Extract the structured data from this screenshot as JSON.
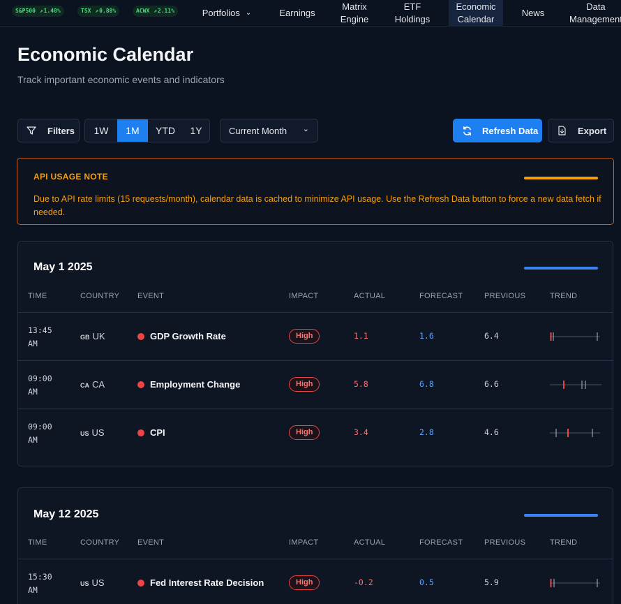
{
  "nav": {
    "tickers": [
      {
        "symbol": "S&P500",
        "change": "1.48%"
      },
      {
        "symbol": "TSX",
        "change": "0.88%"
      },
      {
        "symbol": "ACWX",
        "change": "2.11%"
      }
    ],
    "items": [
      {
        "label": "Portfolios"
      },
      {
        "label": "Earnings"
      },
      {
        "line1": "Matrix",
        "line2": "Engine"
      },
      {
        "line1": "ETF",
        "line2": "Holdings"
      },
      {
        "line1": "Economic",
        "line2": "Calendar"
      },
      {
        "label": "News"
      },
      {
        "line1": "Data",
        "line2": "Management"
      }
    ]
  },
  "page": {
    "title": "Economic Calendar",
    "subtitle": "Track important economic events and indicators"
  },
  "toolbar": {
    "filters_label": "Filters",
    "ranges": [
      "1W",
      "1M",
      "YTD",
      "1Y"
    ],
    "active_range": "1M",
    "period_select": "Current Month",
    "refresh_label": "Refresh Data",
    "export_label": "Export",
    "accent_color": "#1e7ff0"
  },
  "note": {
    "title": "API USAGE NOTE",
    "body": "Due to API rate limits (15 requests/month), calendar data is cached to minimize API usage. Use the Refresh Data button to force a new data fetch if needed."
  },
  "columns": [
    "TIME",
    "COUNTRY",
    "EVENT",
    "IMPACT",
    "ACTUAL",
    "FORECAST",
    "PREVIOUS",
    "TREND"
  ],
  "days": [
    {
      "date": "May 1 2025",
      "events": [
        {
          "time1": "13:45",
          "time2": "AM",
          "country_code": "GB",
          "country": "UK",
          "event": "GDP Growth Rate",
          "impact": "High",
          "actual": "1.1",
          "forecast": "1.6",
          "previous": "6.4"
        },
        {
          "time1": "09:00",
          "time2": "AM",
          "country_code": "CA",
          "country": "CA",
          "event": "Employment Change",
          "impact": "High",
          "actual": "5.8",
          "forecast": "6.8",
          "previous": "6.6"
        },
        {
          "time1": "09:00",
          "time2": "AM",
          "country_code": "US",
          "country": "US",
          "event": "CPI",
          "impact": "High",
          "actual": "3.4",
          "forecast": "2.8",
          "previous": "4.6"
        }
      ]
    },
    {
      "date": "May 12 2025",
      "events": [
        {
          "time1": "15:30",
          "time2": "AM",
          "country_code": "US",
          "country": "US",
          "event": "Fed Interest Rate Decision",
          "impact": "High",
          "actual": "-0.2",
          "forecast": "0.5",
          "previous": "5.9"
        }
      ]
    }
  ]
}
